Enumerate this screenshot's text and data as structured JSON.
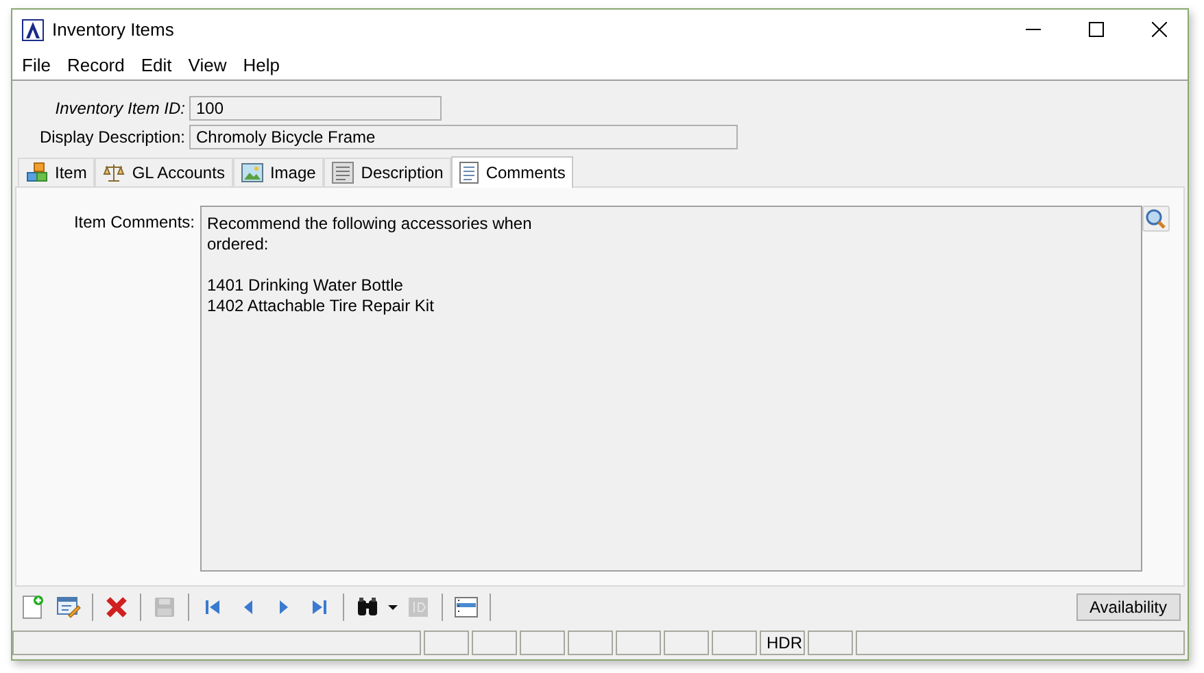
{
  "window": {
    "title": "Inventory Items"
  },
  "menu": [
    "File",
    "Record",
    "Edit",
    "View",
    "Help"
  ],
  "header": {
    "fields": [
      {
        "label": "Inventory Item ID:",
        "value": "100",
        "italic": true,
        "kind": "short"
      },
      {
        "label": "Display Description:",
        "value": "Chromoly Bicycle Frame",
        "italic": false,
        "kind": "long"
      }
    ]
  },
  "tabs": [
    {
      "label": "Item",
      "kind": "item",
      "selected": false
    },
    {
      "label": "GL Accounts",
      "kind": "scale",
      "selected": false
    },
    {
      "label": "Image",
      "kind": "image",
      "selected": false
    },
    {
      "label": "Description",
      "kind": "text",
      "selected": false
    },
    {
      "label": "Comments",
      "kind": "doc",
      "selected": true
    }
  ],
  "comments": {
    "label": "Item Comments:",
    "paragraphs": [
      [
        "Recommend the following accessories when",
        "ordered:"
      ],
      [
        "1401 Drinking Water Bottle",
        "1402 Attachable Tire Repair Kit"
      ]
    ]
  },
  "toolbar": {
    "groups": [
      [
        {
          "kind": "new",
          "disabled": false
        },
        {
          "kind": "edit",
          "disabled": false
        }
      ],
      [
        {
          "kind": "delete",
          "disabled": false
        }
      ],
      [
        {
          "kind": "save",
          "disabled": true
        }
      ],
      [
        {
          "kind": "first",
          "disabled": false
        },
        {
          "kind": "prev",
          "disabled": false
        },
        {
          "kind": "next",
          "disabled": false
        },
        {
          "kind": "last",
          "disabled": false
        }
      ],
      [
        {
          "kind": "find",
          "disabled": false
        },
        {
          "kind": "dropdown",
          "disabled": false
        },
        {
          "kind": "goto",
          "disabled": true
        }
      ],
      [
        {
          "kind": "list",
          "disabled": false
        }
      ]
    ],
    "button": "Availability"
  },
  "status_bar": {
    "indicator": "HDR"
  }
}
